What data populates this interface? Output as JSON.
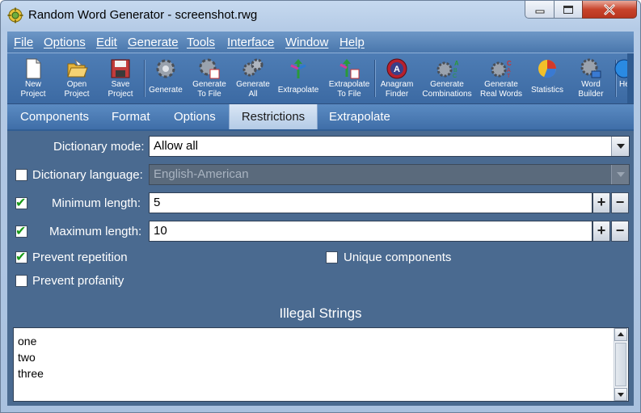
{
  "window": {
    "title": "Random Word Generator - screenshot.rwg",
    "icon": "app-gear-icon",
    "controls": {
      "minimize_icon": "minimize-icon",
      "maximize_icon": "maximize-icon",
      "close_icon": "close-icon"
    }
  },
  "menu": {
    "items": [
      "File",
      "Options",
      "Edit",
      "Generate",
      "Tools",
      "Interface",
      "Window",
      "Help"
    ]
  },
  "toolbar": {
    "buttons": [
      {
        "label": "New\nProject",
        "icon": "new-project-icon"
      },
      {
        "label": "Open\nProject",
        "icon": "open-folder-icon"
      },
      {
        "label": "Save\nProject",
        "icon": "save-disk-icon"
      },
      {
        "label": "Generate",
        "icon": "gear-icon"
      },
      {
        "label": "Generate\nTo File",
        "icon": "gear-file-icon"
      },
      {
        "label": "Generate\nAll",
        "icon": "gears-icon"
      },
      {
        "label": "Extrapolate",
        "icon": "extrapolate-arrows-icon"
      },
      {
        "label": "Extrapolate\nTo File",
        "icon": "extrapolate-file-icon"
      },
      {
        "label": "Anagram\nFinder",
        "icon": "anagram-icon"
      },
      {
        "label": "Generate\nCombinations",
        "icon": "gear-abc-icon"
      },
      {
        "label": "Generate\nReal Words",
        "icon": "gear-cat-icon"
      },
      {
        "label": "Statistics",
        "icon": "pie-chart-icon"
      },
      {
        "label": "Word\nBuilder",
        "icon": "word-builder-icon"
      },
      {
        "label": "He",
        "icon": "help-icon"
      }
    ]
  },
  "tabs": {
    "items": [
      "Components",
      "Format",
      "Options",
      "Restrictions",
      "Extrapolate"
    ],
    "active": "Restrictions"
  },
  "restrictions": {
    "dictionary_mode": {
      "label": "Dictionary mode:",
      "value": "Allow all"
    },
    "dictionary_language": {
      "label": "Dictionary language:",
      "value": "English-American",
      "checked": false,
      "enabled": false
    },
    "minimum_length": {
      "label": "Minimum length:",
      "value": "5",
      "checked": true,
      "plus": "+",
      "minus": "−"
    },
    "maximum_length": {
      "label": "Maximum length:",
      "value": "10",
      "checked": true,
      "plus": "+",
      "minus": "−"
    },
    "prevent_repetition": {
      "label": "Prevent repetition",
      "checked": true
    },
    "unique_components": {
      "label": "Unique components",
      "checked": false
    },
    "prevent_profanity": {
      "label": "Prevent profanity",
      "checked": false
    },
    "illegal_strings": {
      "title": "Illegal Strings",
      "lines": [
        "one",
        "two",
        "three"
      ]
    }
  },
  "colors": {
    "content_bg": "#4a6a90",
    "toolbar_bg": "#3c6aa3",
    "check_green": "#1a9a1a"
  }
}
